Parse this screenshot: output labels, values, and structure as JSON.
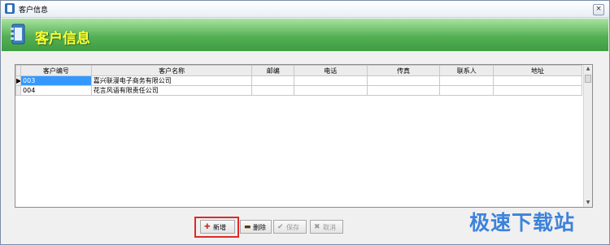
{
  "window": {
    "title": "客户信息",
    "close_glyph": "×"
  },
  "banner": {
    "title": "客户信息"
  },
  "table": {
    "columns": [
      "客户编号",
      "客户名称",
      "邮编",
      "电话",
      "传真",
      "联系人",
      "地址"
    ],
    "rows": [
      {
        "indicator": "▶",
        "cells": [
          "003",
          "嘉兴联漫电子商务有限公司",
          "",
          "",
          "",
          "",
          ""
        ]
      },
      {
        "indicator": "",
        "cells": [
          "004",
          "花言风语有限责任公司",
          "",
          "",
          "",
          "",
          ""
        ]
      }
    ]
  },
  "toolbar": {
    "add": {
      "icon": "plus-icon",
      "label": "新增"
    },
    "delete": {
      "icon": "minus-icon",
      "label": "删除"
    },
    "save": {
      "icon": "check-icon",
      "label": "保存"
    },
    "cancel": {
      "icon": "x-icon",
      "label": "取消"
    }
  },
  "watermark": {
    "text": "极速下载站"
  }
}
